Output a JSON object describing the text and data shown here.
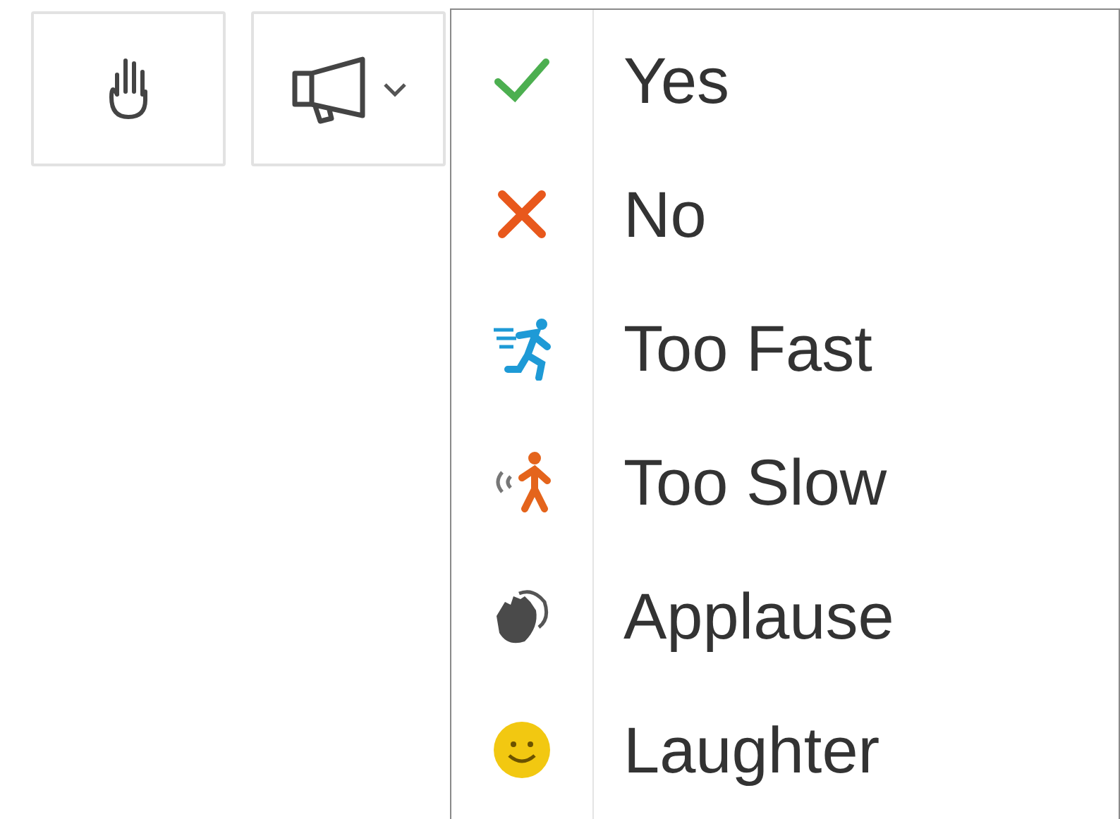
{
  "toolbar": [
    {
      "kind": "hand",
      "has_dropdown": false
    },
    {
      "kind": "megaphone",
      "has_dropdown": true
    }
  ],
  "menu": {
    "items": [
      {
        "label": "Yes",
        "kind": "yes"
      },
      {
        "label": "No",
        "kind": "no"
      },
      {
        "label": "Too Fast",
        "kind": "fast"
      },
      {
        "label": "Too Slow",
        "kind": "slow"
      },
      {
        "label": "Applause",
        "kind": "applause"
      },
      {
        "label": "Laughter",
        "kind": "laughter"
      }
    ]
  }
}
